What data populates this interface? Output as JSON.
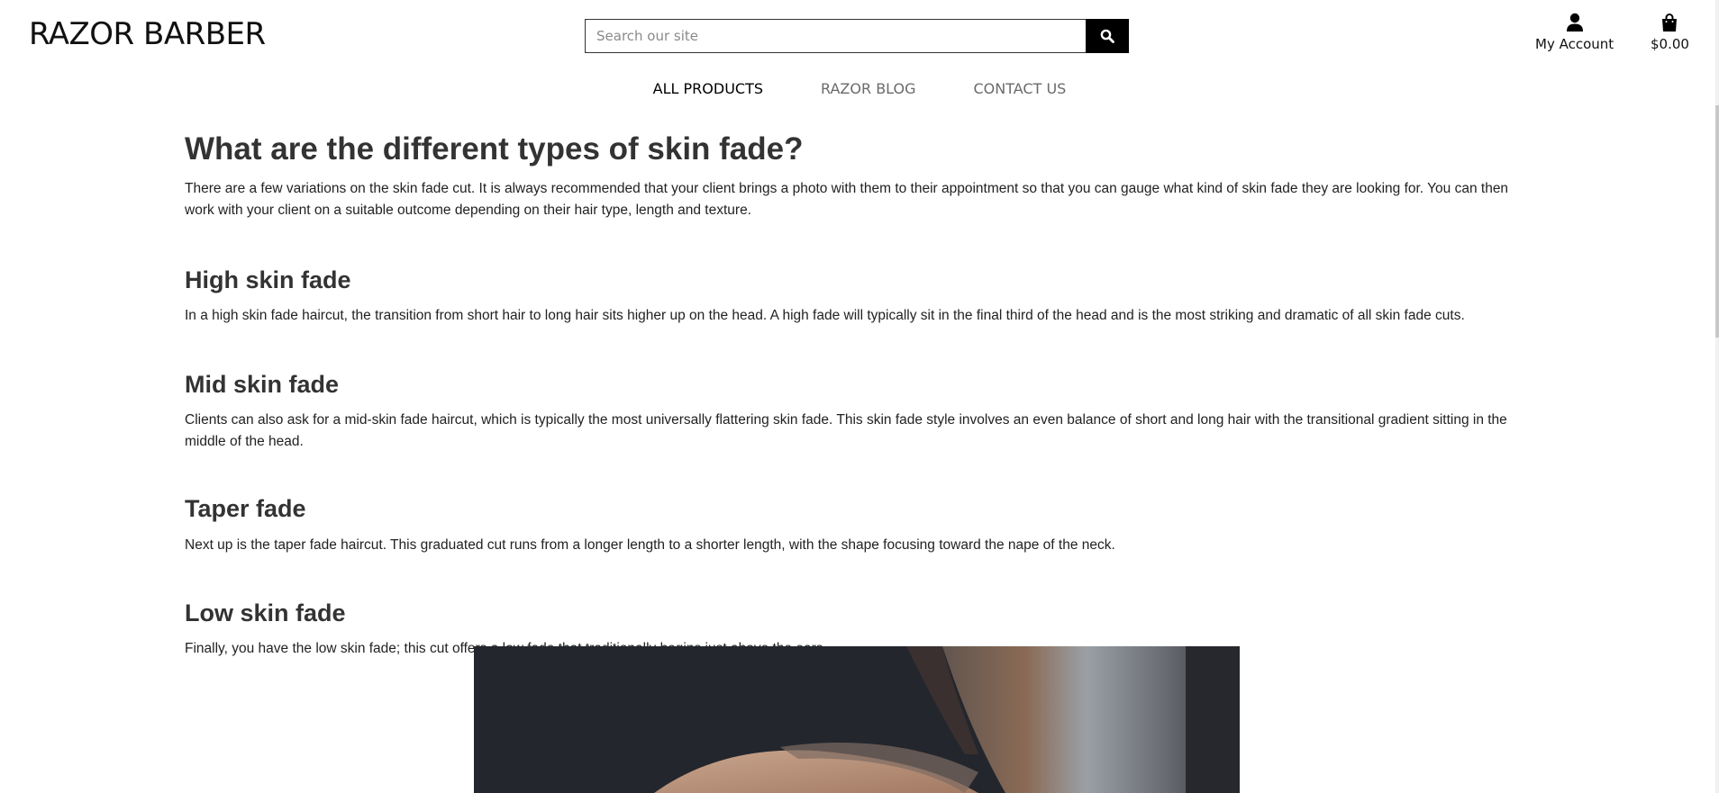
{
  "header": {
    "logo": "RAZOR BARBER",
    "search_placeholder": "Search our site",
    "account_label": "My Account",
    "cart_label": "$0.00"
  },
  "nav": {
    "items": [
      {
        "label": "ALL PRODUCTS"
      },
      {
        "label": "RAZOR BLOG"
      },
      {
        "label": "CONTACT US"
      }
    ]
  },
  "article": {
    "title": "What are the different types of skin fade?",
    "intro": "There are a few variations on the skin fade cut. It is always recommended that your client brings a photo with them to their appointment so that you can gauge what kind of skin fade they are looking for. You can then work with your client on a suitable outcome depending on their hair type, length and texture.",
    "sections": [
      {
        "heading": "High skin fade",
        "text": "In a high skin fade haircut, the transition from short hair to long hair sits higher up on the head. A high fade will typically sit in the final third of the head and is the most striking and dramatic of all skin fade cuts."
      },
      {
        "heading": "Mid skin fade",
        "text": "Clients can also ask for a mid-skin fade haircut, which is typically the most universally flattering skin fade. This skin fade style involves an even balance of short and long hair with the transitional gradient sitting in the middle of the head."
      },
      {
        "heading": "Taper fade",
        "text": "Next up is the taper fade haircut. This graduated cut runs from a longer length to a shorter length, with the shape focusing toward the nape of the neck."
      },
      {
        "heading": "Low skin fade",
        "text": "Finally, you have the low skin fade; this cut offers a low fade that traditionally begins just above the ears."
      }
    ]
  },
  "icons": {
    "search": "search-icon",
    "account": "user-icon",
    "cart": "shopping-bag-icon"
  },
  "colors": {
    "accent": "#000000",
    "heading": "#333333",
    "nav_muted": "#6a6a6a"
  }
}
